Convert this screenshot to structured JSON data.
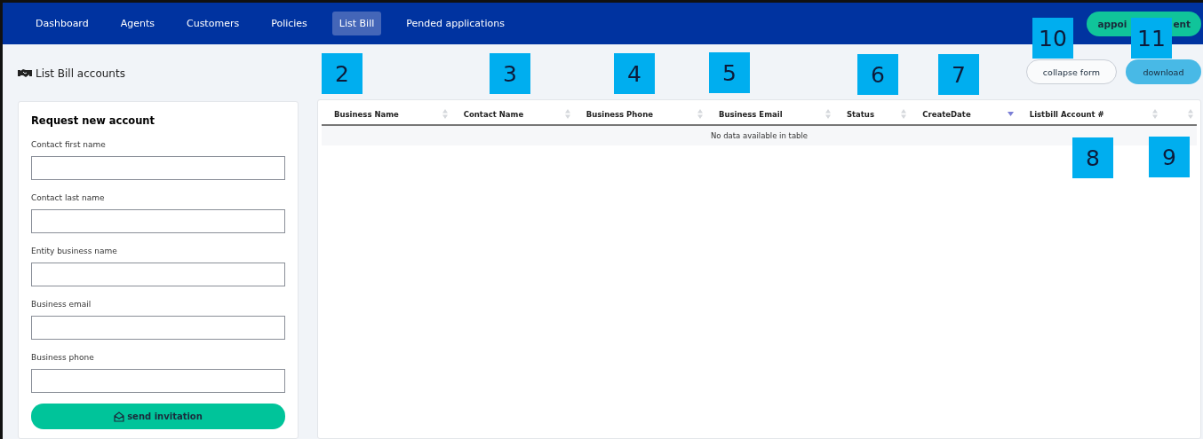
{
  "nav": {
    "items": [
      {
        "label": "Dashboard",
        "selected": false
      },
      {
        "label": "Agents",
        "selected": false
      },
      {
        "label": "Customers",
        "selected": false
      },
      {
        "label": "Policies",
        "selected": false
      },
      {
        "label": "List Bill",
        "selected": true
      },
      {
        "label": "Pended applications",
        "selected": false
      }
    ],
    "action_visible_parts": [
      "appoi",
      "ent"
    ]
  },
  "page_title": "List Bill accounts",
  "form": {
    "title": "Request new account",
    "fields": [
      {
        "label": "Contact first name"
      },
      {
        "label": "Contact last name"
      },
      {
        "label": "Entity business name"
      },
      {
        "label": "Business email"
      },
      {
        "label": "Business phone"
      }
    ],
    "submit": "send invitation"
  },
  "actions": [
    {
      "label": "collapse form",
      "kind": "outline"
    },
    {
      "label": "download",
      "kind": "filled"
    }
  ],
  "table": {
    "columns": [
      {
        "label": "Business Name",
        "sorted": false
      },
      {
        "label": "Contact Name",
        "sorted": false
      },
      {
        "label": "Business Phone",
        "sorted": false
      },
      {
        "label": "Business Email",
        "sorted": false
      },
      {
        "label": "Status",
        "sorted": false
      },
      {
        "label": "CreateDate",
        "sorted": true
      },
      {
        "label": "Listbill Account #",
        "sorted": false
      },
      {
        "sorted": false
      }
    ],
    "empty_message": "No data available in table"
  },
  "callouts": [
    "2",
    "3",
    "4",
    "5",
    "6",
    "7",
    "8",
    "9",
    "10",
    "11"
  ]
}
